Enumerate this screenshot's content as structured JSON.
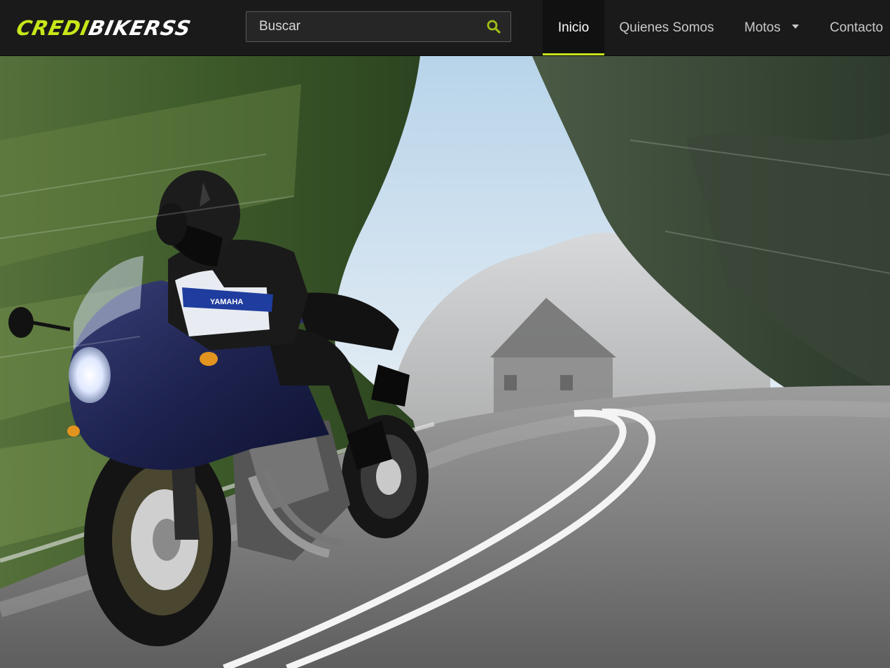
{
  "header": {
    "logo_part1": "CREDI",
    "logo_part2": "BIKERSS",
    "search_placeholder": "Buscar",
    "search_icon": "magnifier-icon",
    "nav": {
      "inicio": "Inicio",
      "quienes": "Quienes Somos",
      "motos": "Motos",
      "contacto": "Contacto"
    },
    "active_item": "Inicio"
  },
  "hero": {
    "jacket_text": "YAMAHA"
  },
  "colors": {
    "accent": "#c8e619",
    "topbar": "#1a1a1a",
    "bike": "#1e2350"
  }
}
